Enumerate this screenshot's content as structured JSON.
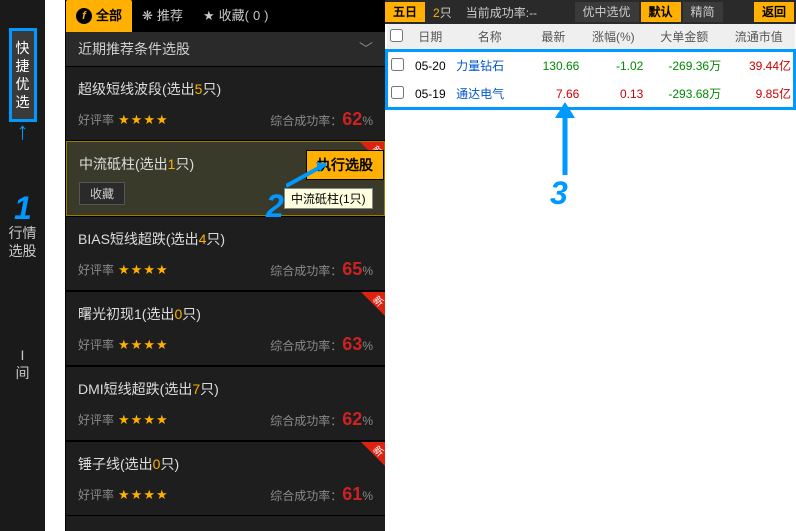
{
  "gutter": {
    "tab_quick": "快捷优选",
    "tab_market": "行情选股",
    "tab_i": "I",
    "tab_q": "间"
  },
  "tabs": {
    "all": "全部",
    "recommend": "推荐",
    "favorites_prefix": "收藏(",
    "favorites_count": "0",
    "favorites_suffix": ")"
  },
  "sub_header": "近期推荐条件选股",
  "labels": {
    "rating": "好评率",
    "success": "综合成功率：",
    "execute": "执行选股",
    "favorite": "收藏",
    "percent": "%"
  },
  "tooltip": "中流砥柱(1只)",
  "items": [
    {
      "title_a": "超级短线波段(选出",
      "count": "5",
      "title_b": "只)",
      "stars": "★★★★",
      "rate": "62",
      "new": false,
      "selected": false
    },
    {
      "title_a": "中流砥柱(选出",
      "count": "1",
      "title_b": "只)",
      "stars": "",
      "rate": "",
      "new": true,
      "selected": true
    },
    {
      "title_a": "BIAS短线超跌(选出",
      "count": "4",
      "title_b": "只)",
      "stars": "★★★★",
      "rate": "65",
      "new": false,
      "selected": false
    },
    {
      "title_a": "曙光初现1(选出",
      "count": "0",
      "title_b": "只)",
      "stars": "★★★★",
      "rate": "63",
      "new": true,
      "selected": false
    },
    {
      "title_a": "DMI短线超跌(选出",
      "count": "7",
      "title_b": "只)",
      "stars": "★★★★",
      "rate": "62",
      "new": false,
      "selected": false
    },
    {
      "title_a": "锤子线(选出",
      "count": "0",
      "title_b": "只)",
      "stars": "★★★★",
      "rate": "61",
      "new": true,
      "selected": false
    }
  ],
  "right_bar": {
    "five_day": "五日",
    "count_val": "2",
    "count_unit": "只",
    "succ_label": "当前成功率:",
    "succ_val": "--",
    "mode": "优中选优",
    "view_default": "默认",
    "view_simple": "精简",
    "back": "返回"
  },
  "grid": {
    "headers": {
      "cb": "",
      "date": "日期",
      "name": "名称",
      "last": "最新",
      "chg": "涨幅(%)",
      "big": "大单金额",
      "cap": "流通市值"
    },
    "rows": [
      {
        "date": "05-20",
        "name": "力量钻石",
        "last": "130.66",
        "chg": "-1.02",
        "big": "-269.36万",
        "cap": "39.44亿",
        "chg_cls": "green",
        "last_cls": "green"
      },
      {
        "date": "05-19",
        "name": "通达电气",
        "last": "7.66",
        "chg": "0.13",
        "big": "-293.68万",
        "cap": "9.85亿",
        "chg_cls": "red",
        "last_cls": "red"
      }
    ]
  },
  "annot": {
    "one": "1",
    "two": "2",
    "three": "3"
  }
}
